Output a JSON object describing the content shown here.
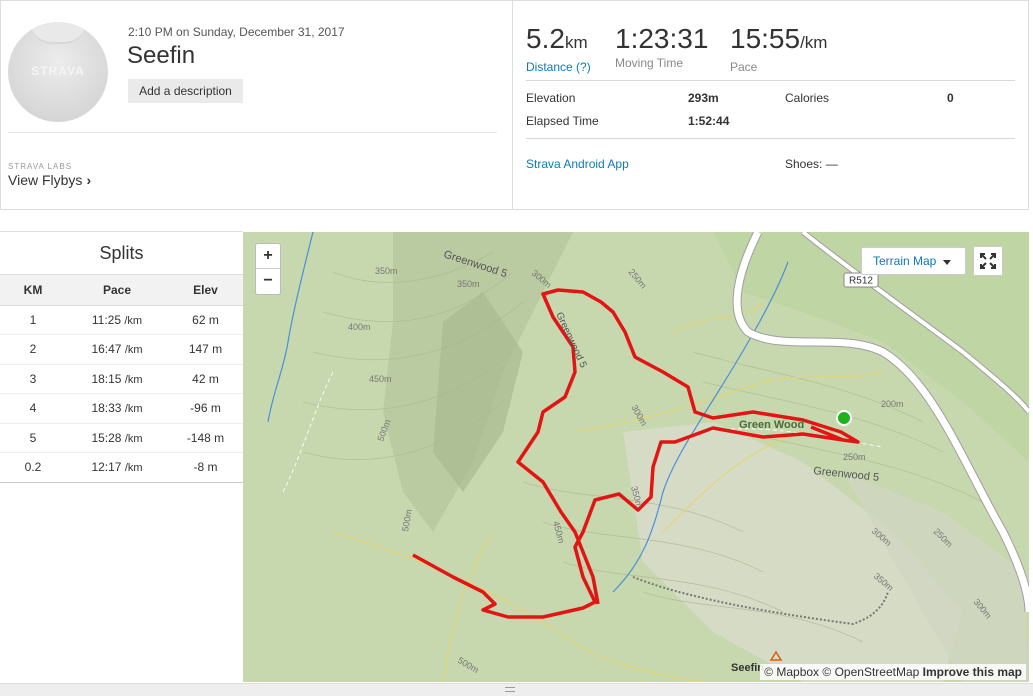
{
  "activity": {
    "datetime": "2:10 PM on Sunday, December 31, 2017",
    "title": "Seefin",
    "add_description": "Add a description",
    "avatar_logo": "STRAVA",
    "labs_tag": "STRAVA LABS",
    "flyby_link": "View Flybys"
  },
  "stats": {
    "distance": {
      "value": "5.2",
      "unit": "km",
      "label": "Distance (?)"
    },
    "moving_time": {
      "value": "1:23:31",
      "label": "Moving Time"
    },
    "pace": {
      "value": "15:55",
      "unit": "/km",
      "label": "Pace"
    },
    "elevation": {
      "label": "Elevation",
      "value": "293m"
    },
    "calories": {
      "label": "Calories",
      "value": "0"
    },
    "elapsed_time": {
      "label": "Elapsed Time",
      "value": "1:52:44"
    },
    "device": "Strava Android App",
    "shoes": "Shoes: —"
  },
  "splits": {
    "title": "Splits",
    "headers": [
      "KM",
      "Pace",
      "Elev"
    ],
    "rows": [
      {
        "km": "1",
        "pace": "11:25",
        "pace_unit": "/km",
        "elev": "62 m"
      },
      {
        "km": "2",
        "pace": "16:47",
        "pace_unit": "/km",
        "elev": "147 m"
      },
      {
        "km": "3",
        "pace": "18:15",
        "pace_unit": "/km",
        "elev": "42 m"
      },
      {
        "km": "4",
        "pace": "18:33",
        "pace_unit": "/km",
        "elev": "-96 m"
      },
      {
        "km": "5",
        "pace": "15:28",
        "pace_unit": "/km",
        "elev": "-148 m"
      },
      {
        "km": "0.2",
        "pace": "12:17",
        "pace_unit": "/km",
        "elev": "-8 m"
      }
    ]
  },
  "map": {
    "zoom_in": "+",
    "zoom_out": "−",
    "layer_button": "Terrain Map",
    "attribution_mapbox": "© Mapbox",
    "attribution_osm": "© OpenStreetMap",
    "attribution_improve": "Improve this map",
    "peak_label": "Seefin",
    "labels": {
      "road": "R512",
      "green_wood": "Green Wood",
      "greenwood5": "Greenwood 5",
      "c350": "350m",
      "c300": "300m",
      "c250": "250m",
      "c200": "200m",
      "c400": "400m",
      "c450": "450m",
      "c500": "500m"
    },
    "colors": {
      "route": "#e31414",
      "start": "#1fb21f",
      "terrain": "#c9d9b1",
      "road": "#ffffff",
      "stream": "#4a90d9"
    }
  }
}
